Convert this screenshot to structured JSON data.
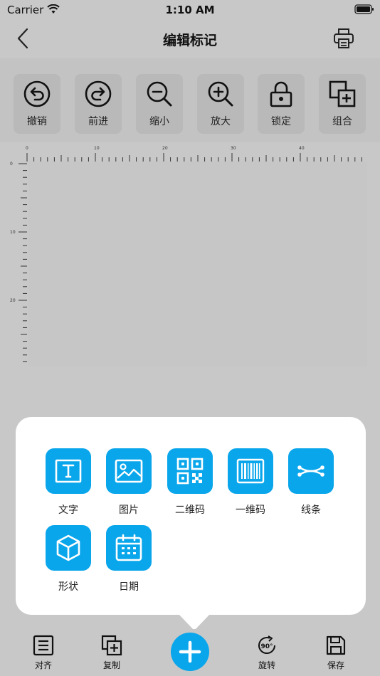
{
  "status": {
    "carrier": "Carrier",
    "time": "1:10 AM"
  },
  "nav": {
    "title": "编辑标记"
  },
  "toolbar": [
    {
      "label": "撤销",
      "icon": "undo-icon"
    },
    {
      "label": "前进",
      "icon": "redo-icon"
    },
    {
      "label": "缩小",
      "icon": "zoom-out-icon"
    },
    {
      "label": "放大",
      "icon": "zoom-in-icon"
    },
    {
      "label": "锁定",
      "icon": "lock-icon"
    },
    {
      "label": "组合",
      "icon": "group-icon"
    }
  ],
  "ruler": {
    "x_ticks": [
      "0",
      "10",
      "20",
      "30",
      "40"
    ],
    "y_ticks": [
      "0",
      "10",
      "20"
    ]
  },
  "elements": [
    {
      "label": "文字",
      "icon": "text-icon"
    },
    {
      "label": "图片",
      "icon": "image-icon"
    },
    {
      "label": "二维码",
      "icon": "qr-code-icon"
    },
    {
      "label": "一维码",
      "icon": "barcode-icon"
    },
    {
      "label": "线条",
      "icon": "line-icon"
    },
    {
      "label": "形状",
      "icon": "shape-icon"
    },
    {
      "label": "日期",
      "icon": "date-icon"
    }
  ],
  "tabbar": {
    "align": "对齐",
    "copy": "复制",
    "rotate": "旋转",
    "rotate_badge": "90°",
    "save": "保存"
  },
  "colors": {
    "accent": "#0aa6eb",
    "background": "#c8c8c8",
    "popup": "#ffffff"
  }
}
